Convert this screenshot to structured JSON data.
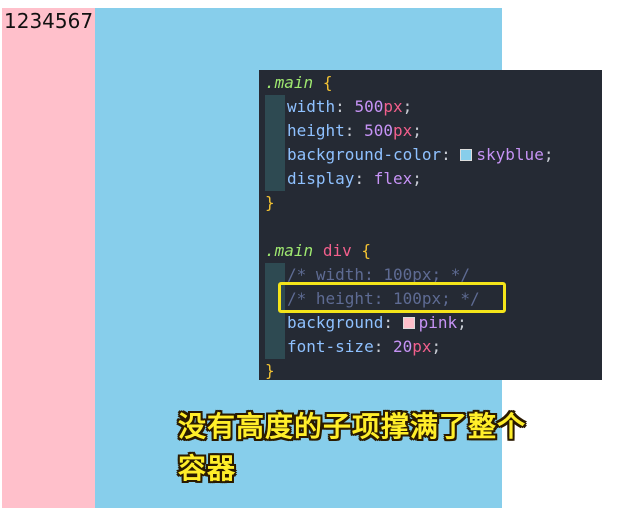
{
  "demo": {
    "child_text": "1234567",
    "colors": {
      "container": "#87ceeb",
      "child": "#ffc0cb"
    }
  },
  "code": {
    "block1": {
      "selector": ".main",
      "open": "{",
      "close": "}",
      "lines": [
        {
          "prop": "width",
          "num": "500",
          "unit": "px"
        },
        {
          "prop": "height",
          "num": "500",
          "unit": "px"
        },
        {
          "prop": "background-color",
          "value": "skyblue",
          "swatch": "#87ceeb"
        },
        {
          "prop": "display",
          "value": "flex"
        }
      ]
    },
    "block2": {
      "selector": ".main",
      "tag": "div",
      "open": "{",
      "close": "}",
      "comment1": "/* width: 100px; */",
      "comment2": "/* height: 100px; */",
      "lines": [
        {
          "prop": "background",
          "value": "pink",
          "swatch": "#ffc0cb"
        },
        {
          "prop": "font-size",
          "num": "20",
          "unit": "px"
        }
      ]
    }
  },
  "annotation": {
    "line1": "没有高度的子项撑满了整个",
    "line2": "容器"
  }
}
